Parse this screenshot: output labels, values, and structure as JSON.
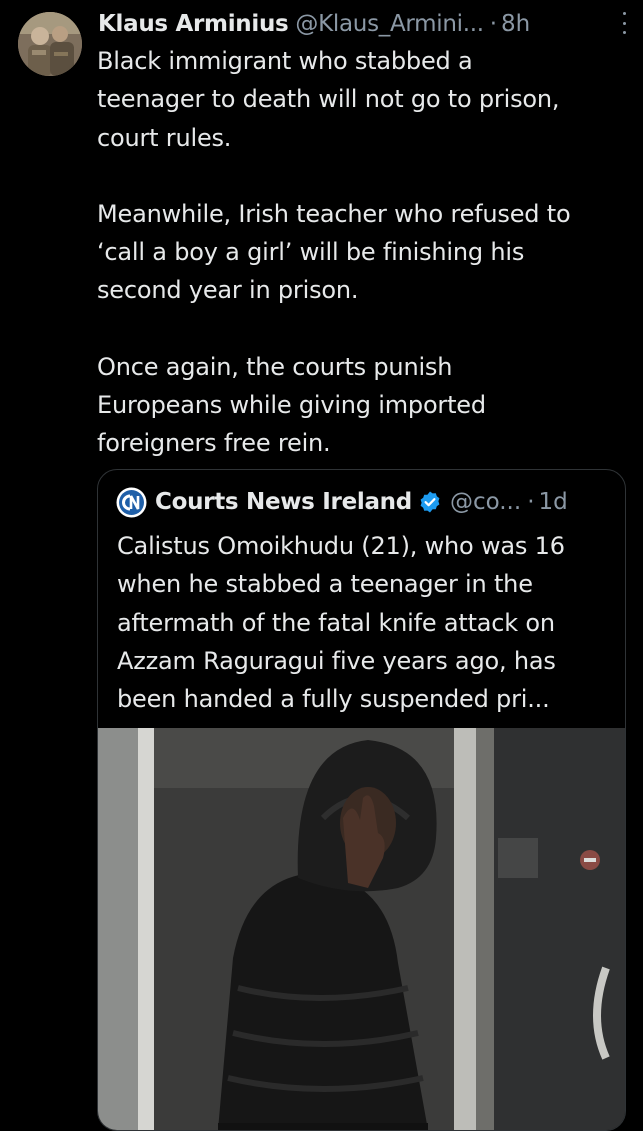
{
  "tweet": {
    "author_name": "Klaus Arminius",
    "author_handle": "@Klaus_Armini...",
    "separator": "·",
    "time": "8h",
    "paragraphs": [
      [
        "Black immigrant who stabbed a",
        "teenager to death will not go to prison,",
        "court rules."
      ],
      [
        "Meanwhile, Irish teacher who refused to",
        "‘call a boy a girl’ will be finishing his",
        "second year in prison."
      ],
      [
        "Once again, the courts punish",
        "Europeans while giving imported",
        "foreigners free rein."
      ]
    ]
  },
  "quote": {
    "author_name": "Courts News Ireland",
    "author_handle": "@co...",
    "separator": "·",
    "time": "1d",
    "text_lines": [
      "Calistus Omoikhudu (21), who was 16",
      "when he stabbed a teenager in the",
      "aftermath of the fatal knife attack on",
      "Azzam Raguragui five years ago, has",
      "been handed a fully suspended pri..."
    ]
  },
  "icons": {
    "avatar": "avatar-photo",
    "more": "more-options-icon",
    "source_logo": "cn-logo-icon",
    "verified": "verified-badge-icon"
  },
  "colors": {
    "background": "#000000",
    "primary_text": "#e7e9ea",
    "secondary_text": "#8b98a5",
    "border": "#2f3336",
    "verified": "#1d9bf0"
  }
}
